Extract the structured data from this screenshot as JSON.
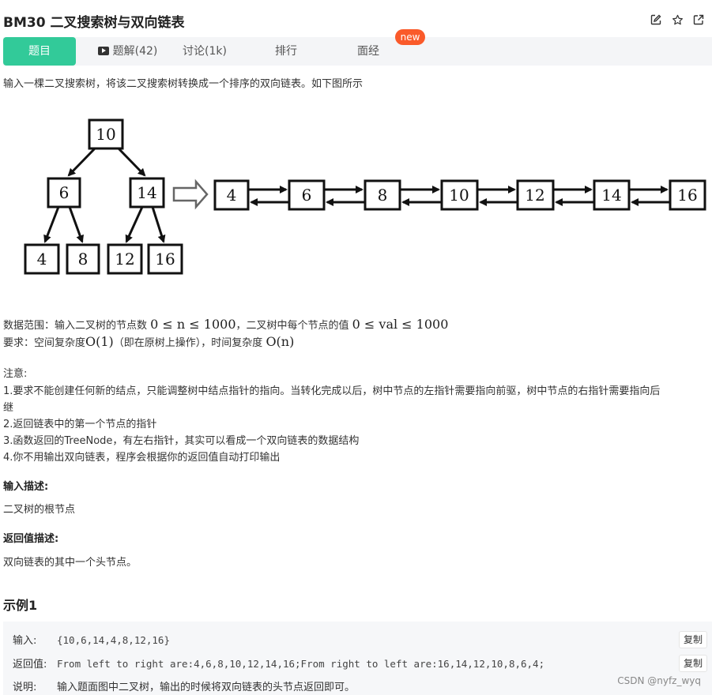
{
  "header": {
    "title": "BM30  二叉搜索树与双向链表"
  },
  "tabs": [
    {
      "label": "题目"
    },
    {
      "label": "题解(42)"
    },
    {
      "label": "讨论(1k)"
    },
    {
      "label": "排行"
    },
    {
      "label": "面经"
    }
  ],
  "new_badge": "new",
  "description": "输入一棵二叉搜索树，将该二叉搜索树转换成一个排序的双向链表。如下图所示",
  "diagram": {
    "tree": {
      "root": "10",
      "level1": [
        "6",
        "14"
      ],
      "level2": [
        "4",
        "8",
        "12",
        "16"
      ]
    },
    "list": [
      "4",
      "6",
      "8",
      "10",
      "12",
      "14",
      "16"
    ]
  },
  "range": {
    "prefix": "数据范围：输入二叉树的节点数 ",
    "n_math": "0 ≤ n ≤ 1000",
    "middle": "，二叉树中每个节点的值 ",
    "val_math": "0 ≤ val ≤ 1000"
  },
  "req": {
    "prefix": "要求：空间复杂度",
    "space_math": "O(1)",
    "middle": "（即在原树上操作），时间复杂度 ",
    "time_math": "O(n)"
  },
  "notes_title": "注意:",
  "notes": [
    "1.要求不能创建任何新的结点，只能调整树中结点指针的指向。当转化完成以后，树中节点的左指针需要指向前驱，树中节点的右指针需要指向后",
    "继",
    "2.返回链表中的第一个节点的指针",
    "3.函数返回的TreeNode，有左右指针，其实可以看成一个双向链表的数据结构",
    "4.你不用输出双向链表，程序会根据你的返回值自动打印输出"
  ],
  "input_desc": {
    "title": "输入描述:",
    "text": "二叉树的根节点"
  },
  "output_desc": {
    "title": "返回值描述:",
    "text": "双向链表的其中一个头节点。"
  },
  "example": {
    "title": "示例1",
    "input_label": "输入:",
    "input_value": "{10,6,14,4,8,12,16}",
    "output_label": "返回值:",
    "output_value": "From left to right are:4,6,8,10,12,14,16;From right to left are:16,14,12,10,8,6,4;",
    "explain_label": "说明:",
    "explain_value": "输入题面图中二叉树，输出的时候将双向链表的头节点返回即可。",
    "copy_label": "复制"
  },
  "watermark": "CSDN @nyfz_wyq"
}
